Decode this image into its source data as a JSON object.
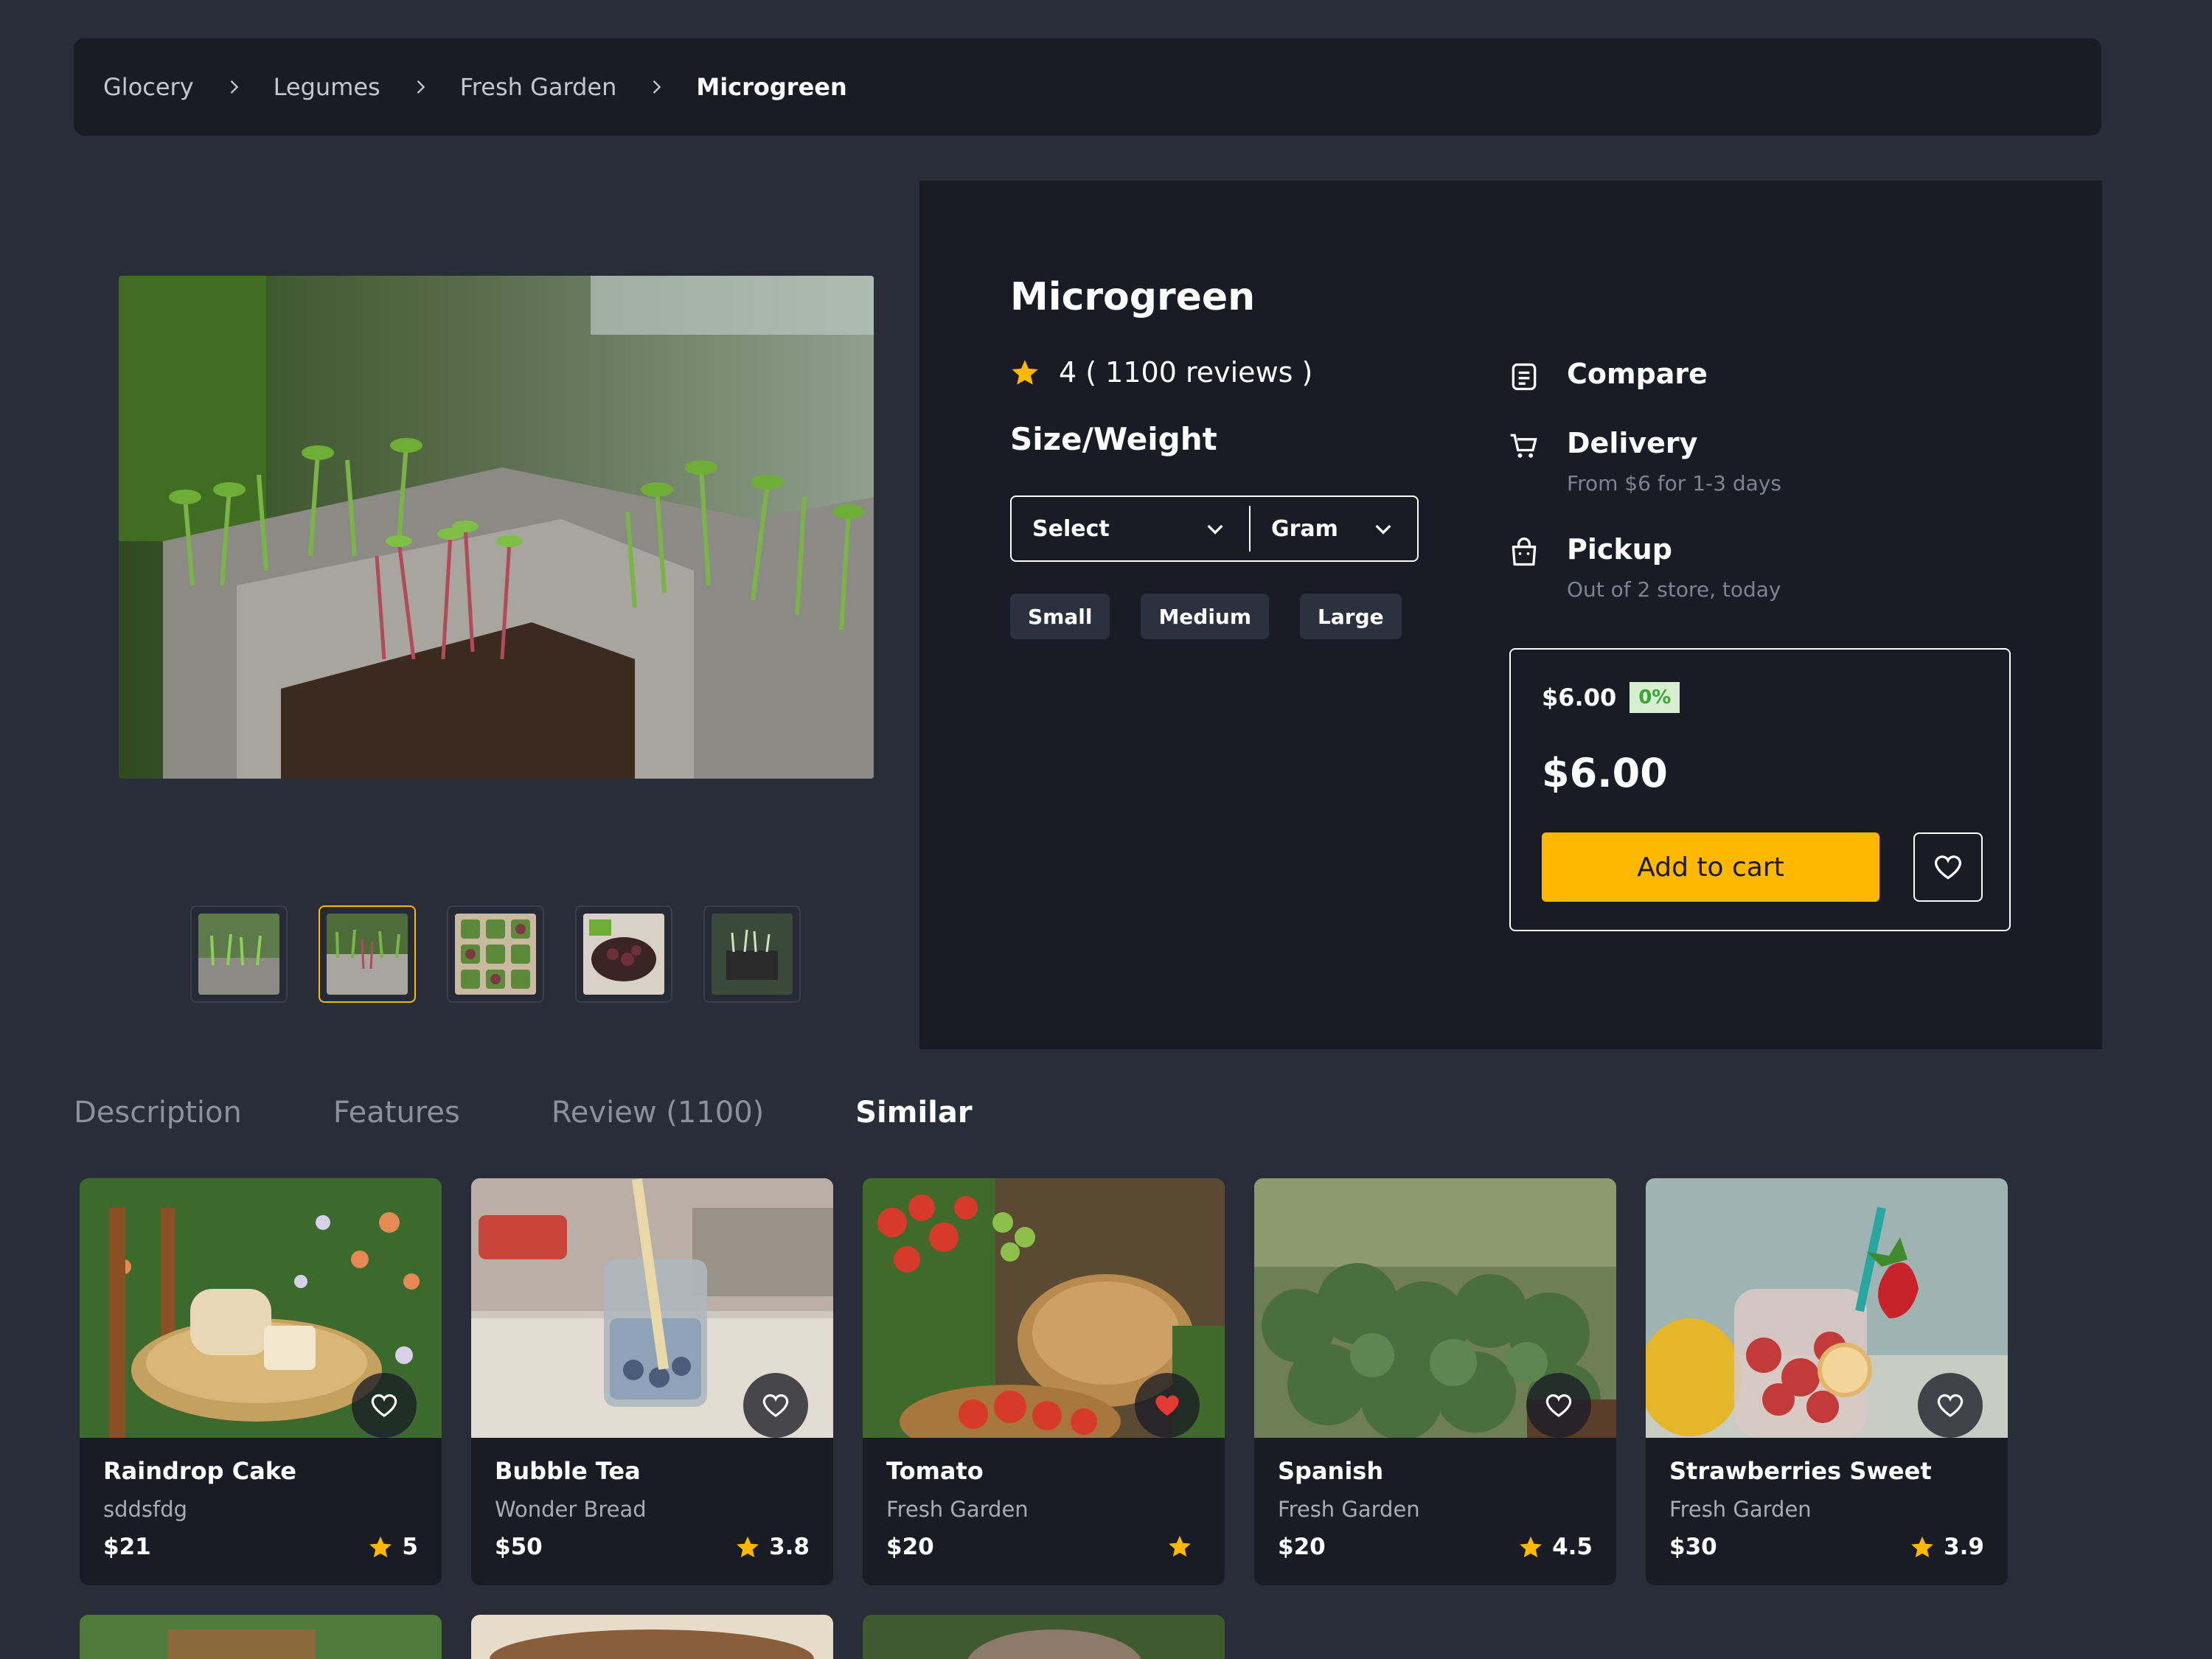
{
  "breadcrumb": {
    "items": [
      "Glocery",
      "Legumes",
      "Fresh Garden"
    ],
    "current": "Microgreen"
  },
  "gallery": {
    "thumbnail_count": 5,
    "active_index": 1
  },
  "product": {
    "title": "Microgreen",
    "rating": "4",
    "reviews": "( 1100 reviews )",
    "size_label": "Size/Weight",
    "select_value": "Select",
    "unit_value": "Gram",
    "sizes": [
      "Small",
      "Medium",
      "Large"
    ]
  },
  "info": {
    "compare": "Compare",
    "delivery_title": "Delivery",
    "delivery_sub": "From $6 for 1-3 days",
    "pickup_title": "Pickup",
    "pickup_sub": "Out of 2 store, today"
  },
  "pricing": {
    "old_price": "$6.00",
    "discount": "0%",
    "price": "$6.00",
    "add_to_cart": "Add to cart"
  },
  "tabs": [
    "Description",
    "Features",
    "Review (1100)",
    "Similar"
  ],
  "active_tab": 3,
  "similar": [
    {
      "name": "Raindrop Cake",
      "store": "sddsfdg",
      "price": "$21",
      "rating": "5",
      "favorite": false
    },
    {
      "name": "Bubble Tea",
      "store": "Wonder Bread",
      "price": "$50",
      "rating": "3.8",
      "favorite": false
    },
    {
      "name": "Tomato",
      "store": "Fresh Garden",
      "price": "$20",
      "rating": "",
      "favorite": true
    },
    {
      "name": "Spanish",
      "store": "Fresh Garden",
      "price": "$20",
      "rating": "4.5",
      "favorite": false
    },
    {
      "name": "Strawberries Sweet",
      "store": "Fresh Garden",
      "price": "$30",
      "rating": "3.9",
      "favorite": false
    }
  ],
  "colors": {
    "accent": "#ffb800",
    "background": "#292d38",
    "panel": "#191c25",
    "favorite": "#e53935"
  },
  "icons": {
    "star": "star-icon",
    "compare": "compare-icon",
    "delivery": "cart-icon",
    "pickup": "bag-icon",
    "wishlist": "heart-icon"
  }
}
